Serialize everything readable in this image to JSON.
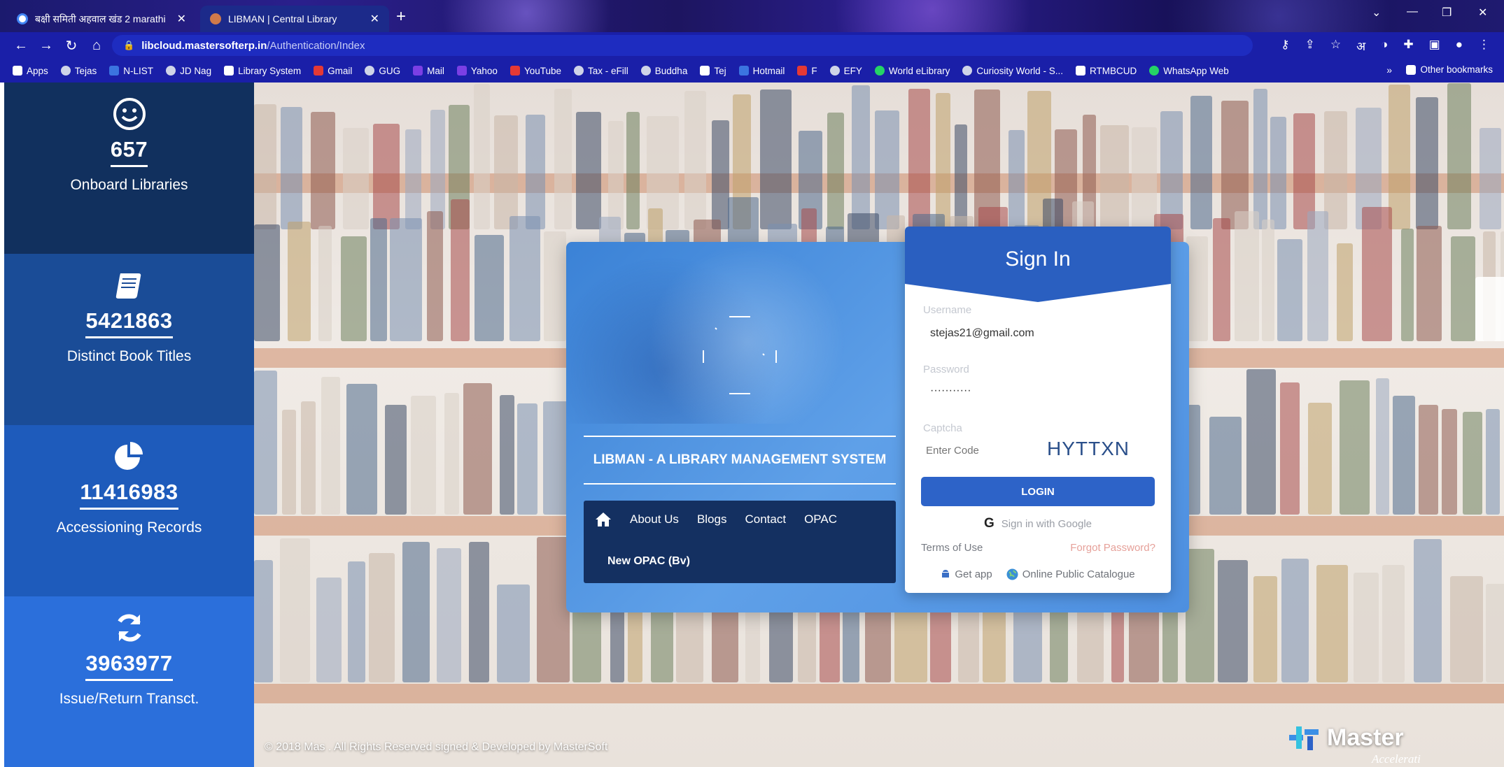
{
  "browser": {
    "tabs": [
      {
        "title": "बक्षी समिती अहवाल खंड 2 marathi",
        "active": false
      },
      {
        "title": "LIBMAN | Central Library",
        "active": true
      }
    ],
    "url_host": "libcloud.mastersofterp.in",
    "url_path": "/Authentication/Index",
    "bookmarks": [
      "Apps",
      "Tejas",
      "N-LIST",
      "JD Nag",
      "Library System",
      "Gmail",
      "GUG",
      "Mail",
      "Yahoo",
      "YouTube",
      "Tax - eFill",
      "Buddha",
      "Tej",
      "Hotmail",
      "F",
      "EFY",
      "World eLibrary",
      "Curiosity World - S...",
      "RTMBCUD",
      "WhatsApp Web"
    ],
    "bookmarks_more": "»",
    "other_bookmarks": "Other bookmarks"
  },
  "stats": [
    {
      "icon": "smiley-icon",
      "value": "657",
      "label": "Onboard Libraries",
      "color": "#11305e"
    },
    {
      "icon": "book-icon",
      "value": "5421863",
      "label": "Distinct Book Titles",
      "color": "#1a4c97"
    },
    {
      "icon": "pie-chart-icon",
      "value": "11416983",
      "label": "Accessioning Records",
      "color": "#1e5bbb"
    },
    {
      "icon": "refresh-icon",
      "value": "3963977",
      "label": "Issue/Return Transct.",
      "color": "#2b6fdb"
    }
  ],
  "panel": {
    "title": "LIBMAN - A LIBRARY MANAGEMENT SYSTEM",
    "nav": [
      "About Us",
      "Blogs",
      "Contact",
      "OPAC"
    ],
    "nav_extra": "New OPAC (Bv)"
  },
  "signin": {
    "title": "Sign In",
    "username_label": "Username",
    "username_value": "stejas21@gmail.com",
    "password_label": "Password",
    "password_value": "···········",
    "captcha_label": "Captcha",
    "captcha_placeholder": "Enter Code",
    "captcha_code": "HYTTXN",
    "login_label": "LOGIN",
    "google_label": "Sign in with Google",
    "terms_label": "Terms of Use",
    "forgot_label": "Forgot Password?",
    "get_app_label": "Get app",
    "opac_label": "Online Public Catalogue"
  },
  "footer": {
    "text": "© 2018 Mas          . All Rights Reserved           signed & Developed by MasterSoft",
    "brand": "Master",
    "brand_tag": "Accelerati"
  },
  "colors": {
    "accent": "#2d63c8",
    "nav_dark": "#143061",
    "forgot": "#e6a19a"
  }
}
